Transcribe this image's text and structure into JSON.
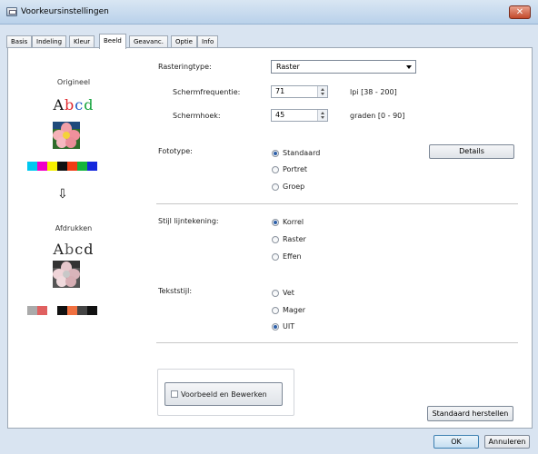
{
  "window": {
    "title": "Voorkeursinstellingen",
    "close_label": "✕"
  },
  "tabs": [
    "Basis",
    "Indeling",
    "Kleur",
    "Beeld",
    "Geavanc.",
    "Optie",
    "Info"
  ],
  "active_tab": "Beeld",
  "preview": {
    "original_label": "Origineel",
    "output_label": "Afdrukken",
    "sample_text": [
      "A",
      "b",
      "c",
      "d"
    ],
    "arrow": "⇩",
    "original_swatches": [
      "#00c8f0",
      "#f000c8",
      "#f5f000",
      "#101010",
      "#f03c14",
      "#14b43c",
      "#1428dc"
    ],
    "output_swatches": [
      "#aaaaaa",
      "#e06060",
      "#ffffff",
      "#111111",
      "#f07040",
      "#444444",
      "#111111"
    ]
  },
  "rastering": {
    "label": "Rasteringtype:",
    "value": "Raster",
    "frequency": {
      "label": "Schermfrequentie:",
      "value": "71",
      "range": "lpi [38 - 200]"
    },
    "angle": {
      "label": "Schermhoek:",
      "value": "45",
      "range": "graden [0 - 90]"
    }
  },
  "photo": {
    "label": "Fototype:",
    "options": [
      "Standaard",
      "Portret",
      "Groep"
    ],
    "selected": 0,
    "details_button": "Details"
  },
  "line_style": {
    "label": "Stijl lijntekening:",
    "options": [
      "Korrel",
      "Raster",
      "Effen"
    ],
    "selected": 0
  },
  "text_style": {
    "label": "Tekststijl:",
    "options": [
      "Vet",
      "Mager",
      "UIT"
    ],
    "selected": 2
  },
  "preview_edit": {
    "label": "Voorbeeld en Bewerken",
    "checked": false
  },
  "buttons": {
    "reset": "Standaard herstellen",
    "ok": "OK",
    "cancel": "Annuleren"
  },
  "colors": {
    "title_bar": "#c7dbf0",
    "frame": "#d9e4f1",
    "close": "#c8553a"
  }
}
